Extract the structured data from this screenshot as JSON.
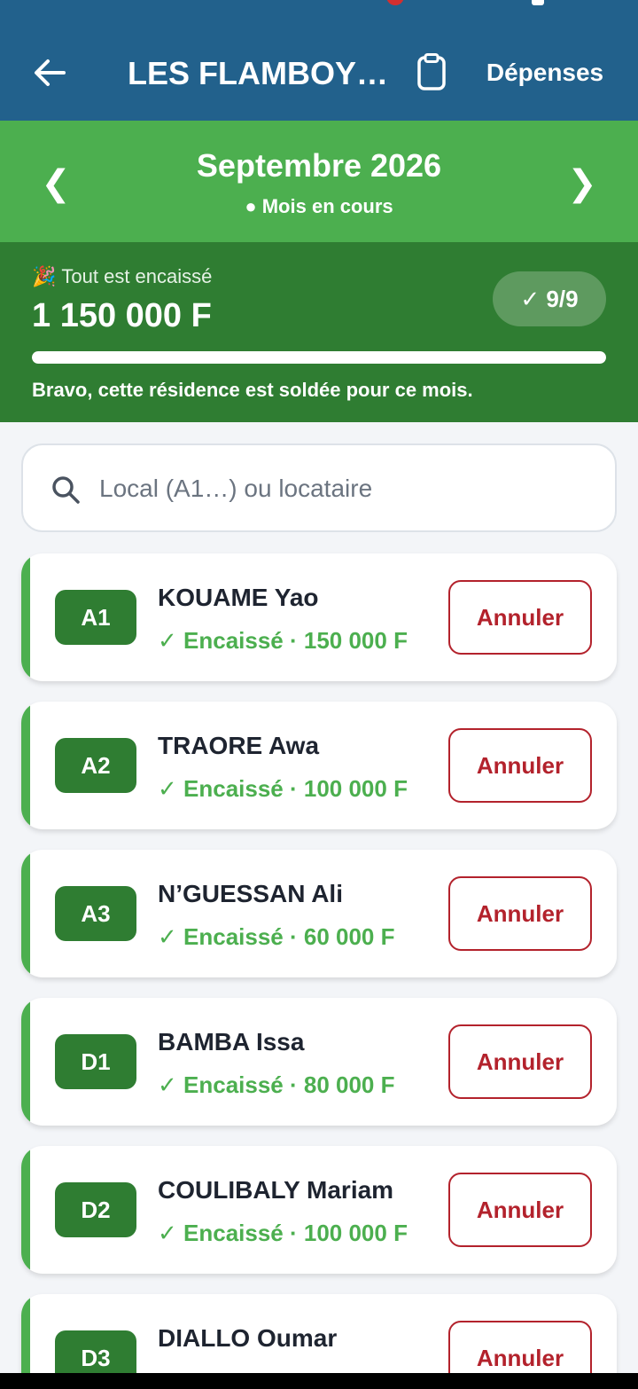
{
  "app_bar": {
    "title": "LES FLAMBOY…",
    "expenses_label": "Dépenses",
    "back_icon": "arrow-left-icon",
    "clipboard_icon": "clipboard-icon",
    "color": "#22618c"
  },
  "month": {
    "title": "Septembre 2026",
    "subtitle": "● Mois en cours",
    "prev_label": "❮",
    "next_label": "❯",
    "color": "#4caf4f"
  },
  "summary": {
    "status": "Tout est encaissé",
    "total": "1 150 000 F",
    "badge": "✓ 9/9",
    "progress": 1.0,
    "note": "Bravo, cette résidence est soldée pour ce mois.",
    "color": "#2f7d32"
  },
  "search": {
    "placeholder": "Local (A1…) ou locataire",
    "value": ""
  },
  "tenants": [
    {
      "unit": "A1",
      "name": "KOUAME Yao",
      "status": "✓ Encaissé · 150 000 F",
      "action": "Annuler"
    },
    {
      "unit": "A2",
      "name": "TRAORE Awa",
      "status": "✓ Encaissé · 100 000 F",
      "action": "Annuler"
    },
    {
      "unit": "A3",
      "name": "N’GUESSAN Ali",
      "status": "✓ Encaissé · 60 000 F",
      "action": "Annuler"
    },
    {
      "unit": "D1",
      "name": "BAMBA Issa",
      "status": "✓ Encaissé · 80 000 F",
      "action": "Annuler"
    },
    {
      "unit": "D2",
      "name": "COULIBALY Mariam",
      "status": "✓ Encaissé · 100 000 F",
      "action": "Annuler"
    },
    {
      "unit": "D3",
      "name": "DIALLO Oumar",
      "status": "",
      "action": "Annuler"
    }
  ],
  "colors": {
    "accent_green": "#4caf4f",
    "dark_green": "#2f7d32",
    "danger": "#b3222c"
  }
}
